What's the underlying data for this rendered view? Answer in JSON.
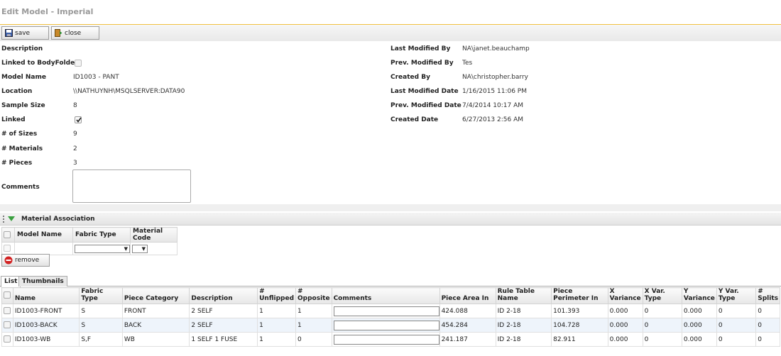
{
  "window": {
    "title": "Edit Model - Imperial"
  },
  "toolbar": {
    "save_label": "save",
    "close_label": "close"
  },
  "form": {
    "left": [
      {
        "label": "Description",
        "value": ""
      },
      {
        "label": "Linked to BodyFolder",
        "value": ""
      },
      {
        "label": "Model Name",
        "value": "ID1003 - PANT"
      },
      {
        "label": "Location",
        "value": "\\\\NATHUYNH\\MSQLSERVER:DATA90"
      },
      {
        "label": "Sample Size",
        "value": "8"
      },
      {
        "label": "Linked",
        "value": ""
      },
      {
        "label": "# of Sizes",
        "value": "9"
      },
      {
        "label": "# Materials",
        "value": "2"
      },
      {
        "label": "# Pieces",
        "value": "3"
      },
      {
        "label": "Comments",
        "value": ""
      }
    ],
    "linked_to_bodyfolder_checked": false,
    "linked_checked": true,
    "right": [
      {
        "label": "Last Modified By",
        "value": "NA\\janet.beauchamp"
      },
      {
        "label": "Prev. Modified By",
        "value": "Tes"
      },
      {
        "label": "Created By",
        "value": "NA\\christopher.barry"
      },
      {
        "label": "Last Modified Date",
        "value": "1/16/2015 11:06 PM"
      },
      {
        "label": "Prev. Modified Date",
        "value": "7/4/2014 10:17 AM"
      },
      {
        "label": "Created Date",
        "value": "6/27/2013 2:56 AM"
      }
    ]
  },
  "material_association": {
    "title": "Material Association",
    "columns": [
      "Model Name",
      "Fabric Type",
      "Material Code"
    ],
    "remove_label": "remove"
  },
  "tabs": [
    {
      "label": "List",
      "active": true
    },
    {
      "label": "Thumbnails",
      "active": false
    }
  ],
  "pieces": {
    "columns": [
      "Name",
      "Fabric Type",
      "Piece Category",
      "Description",
      "# Unflipped",
      "# Opposite",
      "Comments",
      "Piece Area In",
      "Rule Table Name",
      "Piece Perimeter In",
      "X Variance",
      "X Var. Type",
      "Y Variance",
      "Y Var. Type",
      "# Splits"
    ],
    "rows": [
      [
        "ID1003-FRONT",
        "S",
        "FRONT",
        "2 SELF",
        "1",
        "1",
        "",
        "424.088",
        "ID 2-18",
        "101.393",
        "0.000",
        "0",
        "0.000",
        "0",
        "0"
      ],
      [
        "ID1003-BACK",
        "S",
        "BACK",
        "2 SELF",
        "1",
        "1",
        "",
        "454.284",
        "ID 2-18",
        "104.728",
        "0.000",
        "0",
        "0.000",
        "0",
        "0"
      ],
      [
        "ID1003-WB",
        "S,F",
        "WB",
        "1 SELF 1 FUSE",
        "1",
        "0",
        "",
        "241.187",
        "ID 2-18",
        "82.911",
        "0.000",
        "0",
        "0.000",
        "0",
        "0"
      ]
    ]
  },
  "colors": {
    "accent_line": "#f0c040",
    "row_alt": "#eef4fb",
    "remove_icon": "#d22222",
    "collapse_arrow": "#3aa040"
  }
}
